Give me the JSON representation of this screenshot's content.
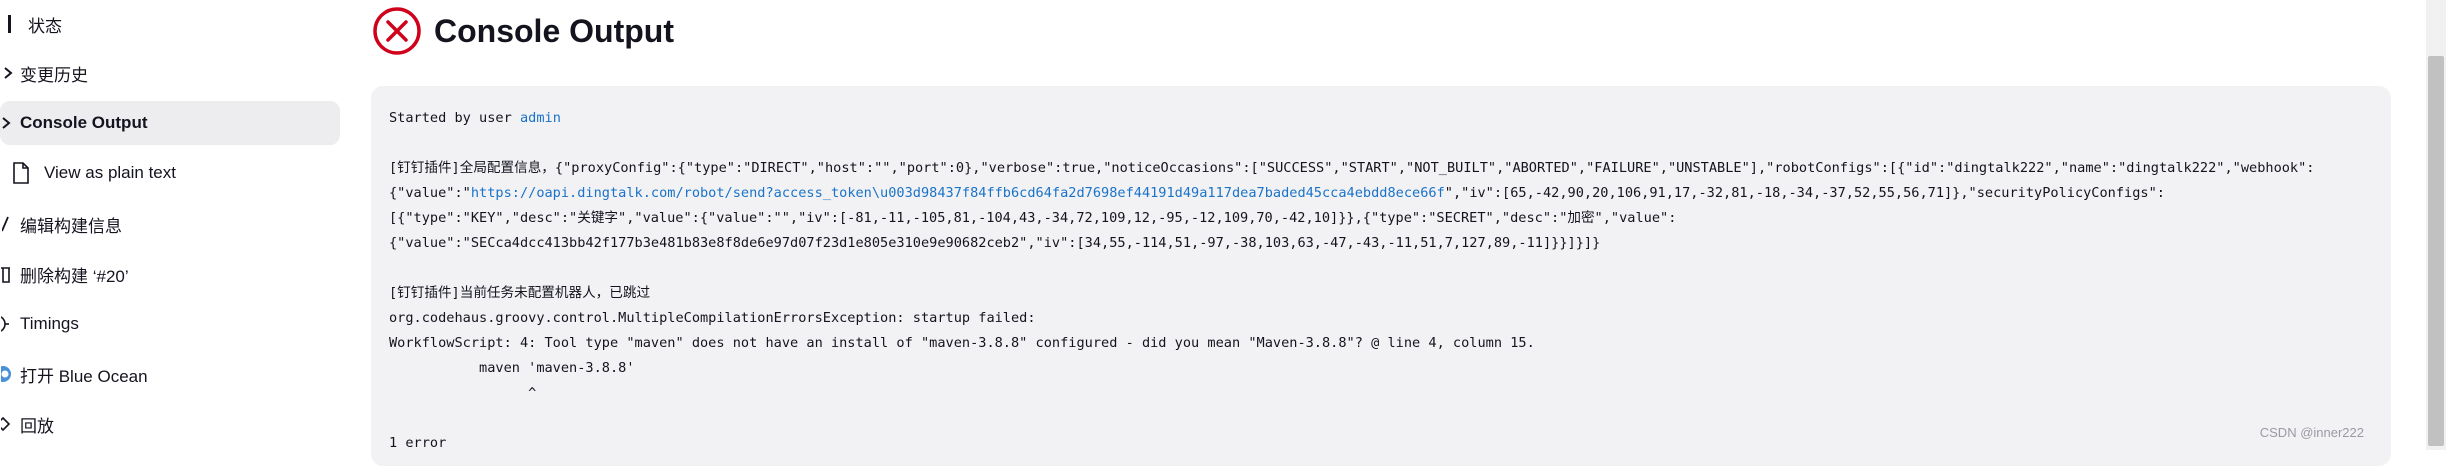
{
  "sidebar": {
    "items": [
      {
        "label": "状态",
        "icon": "status-icon"
      },
      {
        "label": "变更历史",
        "icon": "code-changes-icon"
      },
      {
        "label": "Console Output",
        "icon": "terminal-icon"
      },
      {
        "label": "View as plain text",
        "icon": "document-icon"
      },
      {
        "label": "编辑构建信息",
        "icon": "edit-icon"
      },
      {
        "label": "删除构建 ‘#20’",
        "icon": "trash-icon"
      },
      {
        "label": "Timings",
        "icon": "clock-icon"
      },
      {
        "label": "打开 Blue Ocean",
        "icon": "blue-ocean-icon"
      },
      {
        "label": "回放",
        "icon": "replay-icon"
      }
    ]
  },
  "main": {
    "title": "Console Output",
    "status_color": "#d0021b"
  },
  "console": {
    "started_by_prefix": "Started by user ",
    "started_by_user": "admin",
    "line_config_1": "[钉钉插件]全局配置信息，{\"proxyConfig\":{\"type\":\"DIRECT\",\"host\":\"\",\"port\":0},\"verbose\":true,\"noticeOccasions\":[\"SUCCESS\",\"START\",\"NOT_BUILT\",\"ABORTED\",\"FAILURE\",\"UNSTABLE\"],\"robotConfigs\":[{\"id\":\"dingtalk222\",\"name\":\"dingtalk222\",\"webhook\":",
    "line_config_2_prefix": "{\"value\":\"",
    "webhook_url": "https://oapi.dingtalk.com/robot/send?access_token\\u003d98437f84ffb6cd64fa2d7698ef44191d49a117dea7baded45cca4ebdd8ece66f",
    "line_config_2_suffix": "\",\"iv\":[65,-42,90,20,106,91,17,-32,81,-18,-34,-37,52,55,56,71]},\"securityPolicyConfigs\":",
    "line_config_3": "[{\"type\":\"KEY\",\"desc\":\"关键字\",\"value\":{\"value\":\"\",\"iv\":[-81,-11,-105,81,-104,43,-34,72,109,12,-95,-12,109,70,-42,10]}},{\"type\":\"SECRET\",\"desc\":\"加密\",\"value\":",
    "line_config_4": "{\"value\":\"SECca4dcc413bb42f177b3e481b83e8f8de6e97d07f23d1e805e310e9e90682ceb2\",\"iv\":[34,55,-114,51,-97,-38,103,63,-47,-43,-11,51,7,127,89,-11]}}]}]}",
    "line_no_robot": "[钉钉插件]当前任务未配置机器人，已跳过",
    "line_exception": "org.codehaus.groovy.control.MultipleCompilationErrorsException: startup failed:",
    "line_workflow": "WorkflowScript: 4: Tool type \"maven\" does not have an install of \"maven-3.8.8\" configured - did you mean \"Maven-3.8.8\"? @ line 4, column 15.",
    "line_maven": "           maven 'maven-3.8.8'",
    "line_caret": "                 ^",
    "line_error_count": "1 error"
  },
  "watermark": "CSDN @inner222"
}
